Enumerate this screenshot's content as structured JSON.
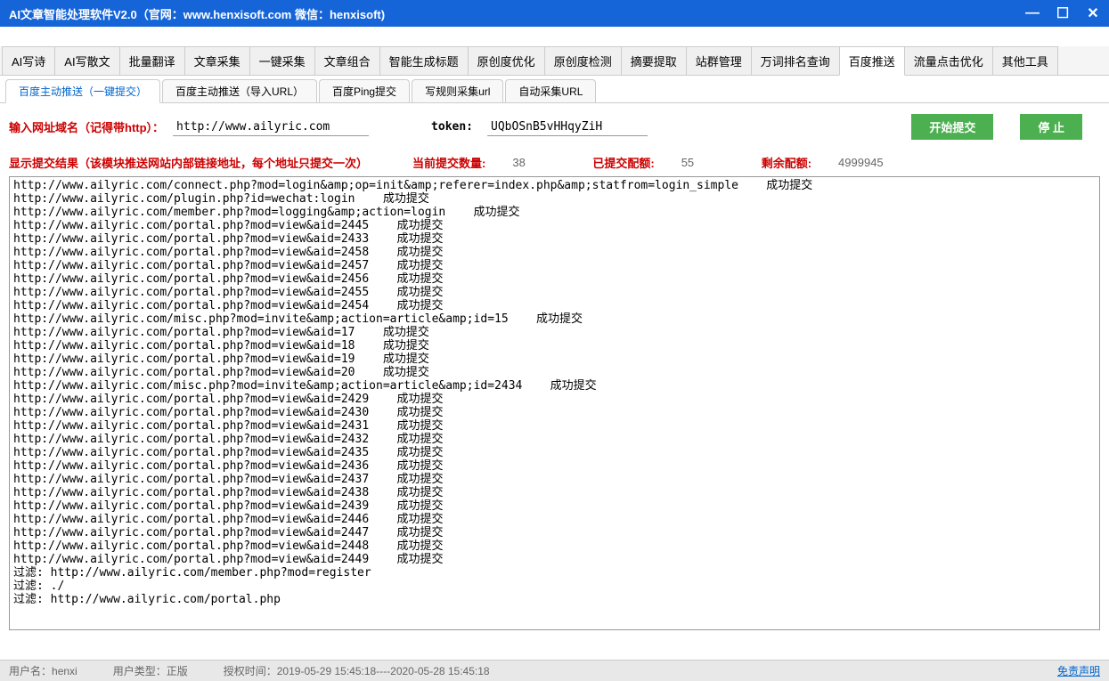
{
  "window": {
    "title": "AI文章智能处理软件V2.0（官网：www.henxisoft.com  微信：henxisoft)"
  },
  "main_tabs": [
    "AI写诗",
    "AI写散文",
    "批量翻译",
    "文章采集",
    "一键采集",
    "文章组合",
    "智能生成标题",
    "原创度优化",
    "原创度检测",
    "摘要提取",
    "站群管理",
    "万词排名查询",
    "百度推送",
    "流量点击优化",
    "其他工具"
  ],
  "main_tab_active": 12,
  "sub_tabs": [
    "百度主动推送（一键提交）",
    "百度主动推送（导入URL）",
    "百度Ping提交",
    "写规则采集url",
    "自动采集URL"
  ],
  "sub_tab_active": 0,
  "form": {
    "url_label": "输入网址域名（记得带http）：",
    "url_value": "http://www.ailyric.com",
    "token_label": "token:",
    "token_value": "UQbOSnB5vHHqyZiH",
    "start_btn": "开始提交",
    "stop_btn": "停  止"
  },
  "status": {
    "result_label": "显示提交结果（该模块推送网站内部链接地址，每个地址只提交一次）",
    "current_label": "当前提交数量:",
    "current_value": "38",
    "submitted_label": "已提交配额:",
    "submitted_value": "55",
    "remaining_label": "剩余配额:",
    "remaining_value": "4999945"
  },
  "log_lines": [
    "http://www.ailyric.com/connect.php?mod=login&amp;op=init&amp;referer=index.php&amp;statfrom=login_simple    成功提交",
    "http://www.ailyric.com/plugin.php?id=wechat:login    成功提交",
    "http://www.ailyric.com/member.php?mod=logging&amp;action=login    成功提交",
    "http://www.ailyric.com/portal.php?mod=view&aid=2445    成功提交",
    "http://www.ailyric.com/portal.php?mod=view&aid=2433    成功提交",
    "http://www.ailyric.com/portal.php?mod=view&aid=2458    成功提交",
    "http://www.ailyric.com/portal.php?mod=view&aid=2457    成功提交",
    "http://www.ailyric.com/portal.php?mod=view&aid=2456    成功提交",
    "http://www.ailyric.com/portal.php?mod=view&aid=2455    成功提交",
    "http://www.ailyric.com/portal.php?mod=view&aid=2454    成功提交",
    "http://www.ailyric.com/misc.php?mod=invite&amp;action=article&amp;id=15    成功提交",
    "http://www.ailyric.com/portal.php?mod=view&aid=17    成功提交",
    "http://www.ailyric.com/portal.php?mod=view&aid=18    成功提交",
    "http://www.ailyric.com/portal.php?mod=view&aid=19    成功提交",
    "http://www.ailyric.com/portal.php?mod=view&aid=20    成功提交",
    "http://www.ailyric.com/misc.php?mod=invite&amp;action=article&amp;id=2434    成功提交",
    "http://www.ailyric.com/portal.php?mod=view&aid=2429    成功提交",
    "http://www.ailyric.com/portal.php?mod=view&aid=2430    成功提交",
    "http://www.ailyric.com/portal.php?mod=view&aid=2431    成功提交",
    "http://www.ailyric.com/portal.php?mod=view&aid=2432    成功提交",
    "http://www.ailyric.com/portal.php?mod=view&aid=2435    成功提交",
    "http://www.ailyric.com/portal.php?mod=view&aid=2436    成功提交",
    "http://www.ailyric.com/portal.php?mod=view&aid=2437    成功提交",
    "http://www.ailyric.com/portal.php?mod=view&aid=2438    成功提交",
    "http://www.ailyric.com/portal.php?mod=view&aid=2439    成功提交",
    "http://www.ailyric.com/portal.php?mod=view&aid=2446    成功提交",
    "http://www.ailyric.com/portal.php?mod=view&aid=2447    成功提交",
    "http://www.ailyric.com/portal.php?mod=view&aid=2448    成功提交",
    "http://www.ailyric.com/portal.php?mod=view&aid=2449    成功提交",
    "",
    "过滤: http://www.ailyric.com/member.php?mod=register",
    "过滤: ./",
    "过滤: http://www.ailyric.com/portal.php"
  ],
  "footer": {
    "user_label": "用户名：",
    "user_value": "henxi",
    "type_label": "用户类型：",
    "type_value": "正版",
    "auth_label": "授权时间：",
    "auth_value": "2019-05-29 15:45:18----2020-05-28 15:45:18",
    "disclaimer": "免责声明"
  }
}
